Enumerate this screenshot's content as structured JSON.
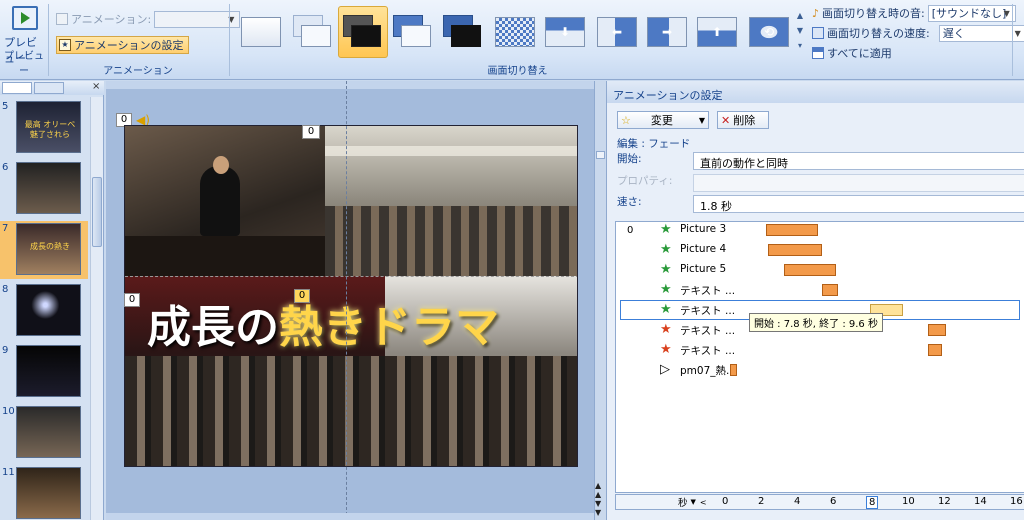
{
  "ribbon": {
    "preview_label": "プレビュー",
    "preview_group": "プレビュー",
    "animation_label": "アニメーション:",
    "animation_settings": "アニメーションの設定",
    "animation_group": "アニメーション",
    "transition_group": "画面切り替え",
    "sound_label": "画面切り替え時の音:",
    "sound_value": "[サウンドなし]",
    "speed_label": "画面切り替えの速度:",
    "speed_value": "遅く",
    "apply_all": "すべてに適用"
  },
  "slides": [
    {
      "num": "5",
      "caption": "最高 オリーベ 魅了されら"
    },
    {
      "num": "6",
      "caption": ""
    },
    {
      "num": "7",
      "caption": "成長の熱き"
    },
    {
      "num": "8",
      "caption": ""
    },
    {
      "num": "9",
      "caption": ""
    },
    {
      "num": "10",
      "caption": ""
    },
    {
      "num": "11",
      "caption": ""
    }
  ],
  "slide": {
    "title_white": "成長の",
    "title_gold": "熱きドラマ",
    "tag1": "0",
    "tag2": "0",
    "tag3": "0",
    "tag4": "0"
  },
  "panel": {
    "title": "アニメーションの設定",
    "change": "変更",
    "delete": "削除",
    "edit_label": "編集 : フェード",
    "start_label": "開始:",
    "start_value": "直前の動作と同時",
    "property_label": "プロパティ:",
    "speed_label": "速さ:",
    "speed_value": "1.8 秒",
    "first_index": "0",
    "items": [
      {
        "name": "Picture 3",
        "color": "#2a9a3a",
        "start": 2.0,
        "end": 4.9
      },
      {
        "name": "Picture 4",
        "color": "#2a9a3a",
        "start": 2.1,
        "end": 5.1
      },
      {
        "name": "Picture 5",
        "color": "#2a9a3a",
        "start": 3.0,
        "end": 5.9
      },
      {
        "name": "テキスト ...",
        "color": "#2a9a3a",
        "start": 5.1,
        "end": 6.0
      },
      {
        "name": "テキスト ...",
        "color": "#2a9a3a",
        "start": 7.8,
        "end": 9.6
      },
      {
        "name": "テキスト ...",
        "color": "#d9411e",
        "start": 11.0,
        "end": 12.0
      },
      {
        "name": "テキスト ...",
        "color": "#d9411e",
        "start": 11.0,
        "end": 11.8
      },
      {
        "name": "pm07_熱...",
        "color": "#000000",
        "start": 0.0,
        "end": 0.4
      }
    ],
    "tooltip": "開始 : 7.8 秒, 終了 : 9.6 秒",
    "seconds_label": "秒",
    "ticks": [
      "0",
      "2",
      "4",
      "6",
      "8",
      "10",
      "12",
      "14",
      "16"
    ]
  }
}
